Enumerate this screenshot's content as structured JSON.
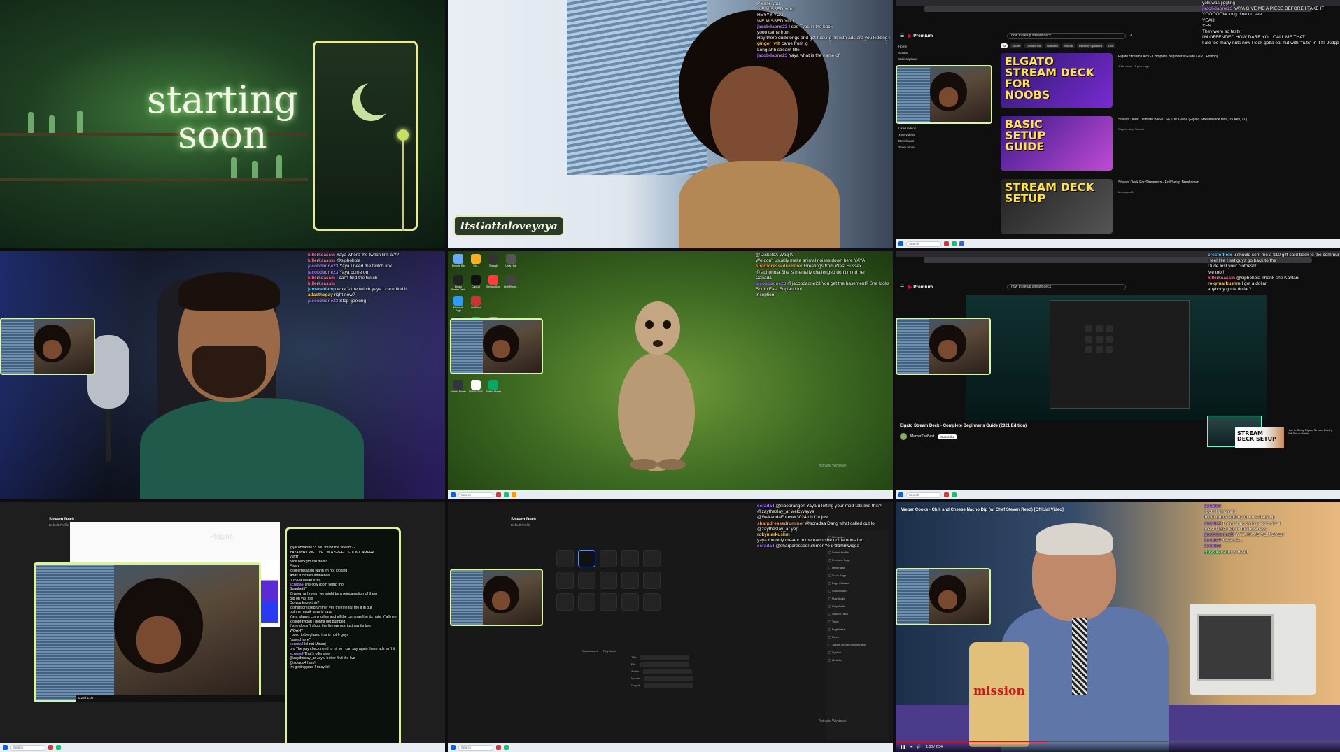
{
  "tile1": {
    "title": "starting\nsoon"
  },
  "tile2": {
    "name_tag": "ItsGottaloveyaya",
    "chat": [
      {
        "user": "",
        "msg": "Please you",
        "c": "cu3"
      },
      {
        "user": "",
        "msg": "WE MISSED YOU",
        "c": "cu2"
      },
      {
        "user": "",
        "msg": "HEYYY YOU",
        "c": "cu4"
      },
      {
        "user": "",
        "msg": "WE MISSED YUU",
        "c": "cu5"
      },
      {
        "user": "jacobdaone23",
        "msg": "I see Tyas in the back",
        "c": "cu1"
      },
      {
        "user": "",
        "msg": "yooo came from",
        "c": "cu2"
      },
      {
        "user": "",
        "msg": "Hey there dudotongs and got fucking hit with ads are you kidding me",
        "c": "cu3"
      },
      {
        "user": "ginger_vtlt",
        "msg": "came from ig",
        "c": "cu4"
      },
      {
        "user": "",
        "msg": "Long ahh stream title",
        "c": "cu5"
      },
      {
        "user": "jacobdaone23",
        "msg": "Yaya what is the name of",
        "c": "cu1"
      }
    ]
  },
  "tile3": {
    "brand": "Premium",
    "search": "how to setup stream deck",
    "chips": [
      "All",
      "Shorts",
      "Unwatched",
      "Watched",
      "Videos",
      "Recently uploaded",
      "Live"
    ],
    "sidebar": [
      "Home",
      "Shorts",
      "Subscriptions",
      "",
      "WEBTOON",
      "SkrMosh The Glo...",
      "Show more",
      "",
      "You",
      "Your channel",
      "History",
      "Playlists",
      "Watch later",
      "Liked videos",
      "Your videos",
      "Downloads",
      "Show more"
    ],
    "results": [
      {
        "thumb": "ELGATO\nSTREAM DECK\nFOR\nNOOBS",
        "title": "Elgato Stream Deck - Complete Beginner's Guide (2021 Edition)",
        "meta": "1.1M views · 3 years ago"
      },
      {
        "thumb": "BASIC\nSETUP\nGUIDE",
        "title": "Stream Deck: Ultimate BASIC SETUP Guide (Elgato StreamDeck Mini, 15 Key, XL)",
        "meta": "Step-by-step Tutorial"
      },
      {
        "thumb": "STREAM DECK\nSETUP",
        "title": "Stream Deck For Streamers - Full Setup Breakdown",
        "meta": "Mercugan-Bt"
      }
    ],
    "chat": [
      {
        "user": "",
        "msg": "yolk was jiggling",
        "c": "cu3"
      },
      {
        "user": "jacobdaone23",
        "msg": "YAYA GIVE ME A PIECE BEFORE I TAKE IT",
        "c": "cu1"
      },
      {
        "user": "",
        "msg": "YOOOOOW long time no see",
        "c": "cu2"
      },
      {
        "user": "",
        "msg": "YEAH",
        "c": "cu4"
      },
      {
        "user": "",
        "msg": "YES",
        "c": "cu5"
      },
      {
        "user": "",
        "msg": "They were so tasty",
        "c": "cu6"
      },
      {
        "user": "",
        "msg": "I'M OFFENDED HOW DARE YOU CALL ME THAT",
        "c": "cu2"
      },
      {
        "user": "",
        "msg": "I ate too many nuts now I look gotta eat nut with \"nuts\" in it till Judgement Day",
        "c": "cu3"
      }
    ]
  },
  "tile4": {
    "chat": [
      {
        "user": "killerksassin",
        "msg": "Yaya where the twitch link at??",
        "c": "cu2"
      },
      {
        "user": "killerksassin",
        "msg": "@siphohola",
        "c": "cu2"
      },
      {
        "user": "jacobdaone23",
        "msg": "Yaya I need the twitch link",
        "c": "cu1"
      },
      {
        "user": "jacobdaone23",
        "msg": "Yaya come on",
        "c": "cu1"
      },
      {
        "user": "killerksassin",
        "msg": "I can't find the twitch",
        "c": "cu2"
      },
      {
        "user": "killerksassin",
        "msg": "",
        "c": "cu2"
      },
      {
        "user": "jamaraldamp",
        "msg": "what's the twitch yaya I can't find it",
        "c": "cu3"
      },
      {
        "user": "atlasthegay",
        "msg": "right now?",
        "c": "cu4"
      },
      {
        "user": "jacobdaone23",
        "msg": "Stop geeking",
        "c": "cu1"
      }
    ]
  },
  "tile5": {
    "icons": [
      "Recycle Bin",
      "Sh...",
      "Shopsk",
      "Unity Hub",
      "Elgato Stream Deck",
      "CapCut",
      "Serious Sam",
      "UnityRecm...",
      "Microsoft Edge",
      "LastPass",
      "",
      "",
      "OBS Studio",
      "Stuff to Writeup",
      "Stan Proofing",
      "",
      "Rate Land Tag",
      "Steam",
      "Epic Games Launcher",
      "",
      "Adobe Creative",
      "Meta Quest Link",
      "Roblox Studio",
      "",
      "Whiskr Player",
      "ROCKSTAR",
      "Roblox Player",
      "",
      "",
      "",
      ""
    ],
    "chat": [
      {
        "user": "",
        "msg": "@DiskeleX Wag K",
        "c": "cu2"
      },
      {
        "user": "",
        "msg": "We don't usually make animal noises down here YAYA",
        "c": "cu3"
      },
      {
        "user": "sharpdressedrummer",
        "msg": "Greetings from West Sussex",
        "c": "cu6"
      },
      {
        "user": "",
        "msg": "@siphohola She is mentally challenged don't mind her",
        "c": "cu1"
      },
      {
        "user": "",
        "msg": "Canada",
        "c": "cu4"
      },
      {
        "user": "jacobdaone23",
        "msg": "@jacobdaone23 You get the basement? She locks the in her left room (is is treacherous)",
        "c": "cu1"
      },
      {
        "user": "",
        "msg": "South East England lol",
        "c": "cu5"
      },
      {
        "user": "",
        "msg": "Inception",
        "c": "cu2"
      }
    ],
    "watermark": "Activate Windows"
  },
  "tile6": {
    "search": "how to setup stream deck",
    "brand": "Premium",
    "player_title": "Elgato Stream Deck - Complete Beginner's Guide (2021 Edition)",
    "channel": "MarkerTheBest",
    "subscribe": "Subscribe",
    "side_thumb": "STREAM\nDECK SETUP",
    "side_title": "How to Setup Elgato Stream Deck | Full Setup Guide",
    "chat": [
      {
        "user": "crestothelx",
        "msg": "u should sent me a $10 gift card back to the community",
        "c": "cu3"
      },
      {
        "user": "",
        "msg": "i feel like I set guys go back to the",
        "c": "cu4"
      },
      {
        "user": "",
        "msg": "Dude lost your clothes!!!",
        "c": "cu2"
      },
      {
        "user": "",
        "msg": "Me too!!",
        "c": "cu5"
      },
      {
        "user": "killerksassin",
        "msg": "@siphohola Thank she Kahlani",
        "c": "cu2"
      },
      {
        "user": "rokymarkushm",
        "msg": "I got a dollar",
        "c": "cu4"
      },
      {
        "user": "",
        "msg": "anybody gotta dollar?",
        "c": "cu1"
      }
    ]
  },
  "tile7": {
    "app": "Stream Deck",
    "profile": "Default Profile",
    "heading": "Plugins",
    "player_time": "0:26 / 1:00",
    "chat": [
      {
        "user": "",
        "msg": "@jacobdaone23 You found the stream??",
        "c": "cu1"
      },
      {
        "user": "",
        "msg": "YAYA WHY WE LIVE ON A SPEED STICK CAMERA",
        "c": "cu2"
      },
      {
        "user": "",
        "msg": "yurrrr",
        "c": "cu3"
      },
      {
        "user": "",
        "msg": "Nice background music",
        "c": "cu4"
      },
      {
        "user": "",
        "msg": "Flippy",
        "c": "cu5"
      },
      {
        "user": "",
        "msg": "@sillerrssassin Nahh im not looking",
        "c": "cu6"
      },
      {
        "user": "",
        "msg": "Adds a certain ambience",
        "c": "cu3"
      },
      {
        "user": "",
        "msg": "my cow mean eyes",
        "c": "cu2"
      },
      {
        "user": "scrada4",
        "msg": "The cow room setup tho",
        "c": "cu1"
      },
      {
        "user": "",
        "msg": "Spaghetti?",
        "c": "cu4"
      },
      {
        "user": "",
        "msg": "@yaya_ar I mean we might be a reincarnation of them",
        "c": "cu5"
      },
      {
        "user": "",
        "msg": "Big oh yay sss",
        "c": "cu3"
      },
      {
        "user": "",
        "msg": "Do you know this?",
        "c": "cu2"
      },
      {
        "user": "",
        "msg": "@sharpdressedrummer yes the fine fail the it in but",
        "c": "cu6"
      },
      {
        "user": "",
        "msg": "put me magik says is yaya",
        "c": "cu4"
      },
      {
        "user": "",
        "msg": "Yaya always coming live and all the cameras like its hate, Y'all need to chill",
        "c": "cu1"
      },
      {
        "user": "",
        "msg": "@siopravigari I gonna get pumped",
        "c": "cu2"
      },
      {
        "user": "",
        "msg": "if she doesn't shoot the live we gon just say its bye",
        "c": "cu3"
      },
      {
        "user": "",
        "msg": "WOAH?",
        "c": "cu5"
      },
      {
        "user": "",
        "msg": "I used to be glazed this is not 6 guys",
        "c": "cu4"
      },
      {
        "user": "",
        "msg": "\"speed here\"",
        "c": "cu2"
      },
      {
        "user": "scrada4",
        "msg": "lol not Minaaj",
        "c": "cu1"
      },
      {
        "user": "",
        "msg": "bro The pay check need to hit so I can say again these ads ain't it",
        "c": "cu3"
      },
      {
        "user": "scrada4",
        "msg": "That's offensive",
        "c": "cu1"
      },
      {
        "user": "",
        "msg": "@zaytheslay_ar Jay u better find the live",
        "c": "cu6"
      },
      {
        "user": "",
        "msg": "@scrada4 I am!",
        "c": "cu5"
      },
      {
        "user": "",
        "msg": "Im getting paid Friday lol",
        "c": "cu4"
      }
    ]
  },
  "tile8": {
    "app": "Stream Deck",
    "profile": "Default Profile",
    "panel_tabs": [
      "Soundboard",
      "Play Audio"
    ],
    "panel_rows": [
      "Title",
      "File",
      "Action",
      "Volume",
      "Output"
    ],
    "right_list": [
      "Navigation",
      "Create Folder",
      "Switch Profile",
      "Previous Page",
      "Next Page",
      "Go to Page",
      "Page Indicator",
      "Soundboard",
      "Play Audio",
      "Stop Audio",
      "Stream Deck",
      "Timer",
      "Brightness",
      "Sleep",
      "Toggle Virtual Stream Deck",
      "System",
      "Website"
    ],
    "chat": [
      {
        "user": "scrada4",
        "msg": "@siaeprangerl Yaya u letting your mod-talk like this?",
        "c": "cu1"
      },
      {
        "user": "",
        "msg": "@zaytheslay_ar welcvyayya",
        "c": "cu3"
      },
      {
        "user": "",
        "msg": "@WakandaForever3024 oh I'm just",
        "c": "cu2"
      },
      {
        "user": "sharpdressedrummer",
        "msg": "@scradaa Dang what called out lol",
        "c": "cu6"
      },
      {
        "user": "",
        "msg": "@zaytheslay_ar yep",
        "c": "cu4"
      },
      {
        "user": "rokymarkushm",
        "msg": "",
        "c": "cu4"
      },
      {
        "user": "",
        "msg": "yaya the only creator in the earth she not famous bro",
        "c": "cu3"
      },
      {
        "user": "scrada4",
        "msg": "@sharpdressedrummer Ye u damn wigga",
        "c": "cu1"
      }
    ],
    "watermark": "Activate Windows"
  },
  "tile9": {
    "video_title": "Weber Cooks - Chili and Cheese Nacho Dip (w/ Chef Steven Reed) [Official Video]",
    "bag_label": "mission",
    "time": "1:00 / 2:54",
    "chat": [
      {
        "user": "scrada4",
        "msg": "",
        "c": "cu1"
      },
      {
        "user": "",
        "msg": "I got start crying",
        "c": "cu2"
      },
      {
        "user": "",
        "msg": "to get drunk and try to do a backflip",
        "c": "cu3"
      },
      {
        "user": "scrada4",
        "msg": "Them start crying pools of oil",
        "c": "cu1"
      },
      {
        "user": "",
        "msg": "finest facial hair in the business",
        "c": "cu4"
      },
      {
        "user": "jacobdaone23",
        "msg": "YAYA HAVE YOU EVER",
        "c": "cu1"
      },
      {
        "user": "scrada4",
        "msg": "Yaya wa...",
        "c": "cu1"
      },
      {
        "user": "scrada4",
        "msg": "",
        "c": "cu1"
      },
      {
        "user": "coryskershin",
        "msg": "is dead",
        "c": "cu5"
      }
    ]
  }
}
